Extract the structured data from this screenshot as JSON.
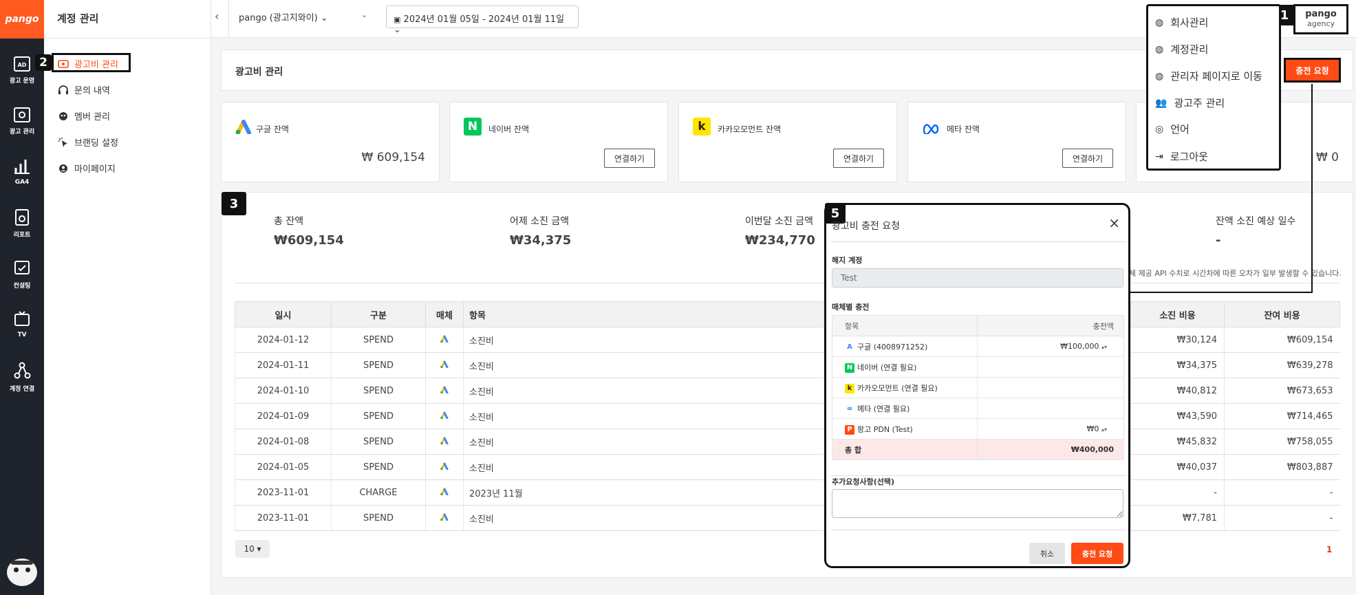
{
  "brand": {
    "logo_text": "pango",
    "accent": "#ff4b14"
  },
  "rail": [
    {
      "label": "광고 운영",
      "icon": "ad-icon"
    },
    {
      "label": "광고 관리",
      "icon": "gear-icon"
    },
    {
      "label": "GA4",
      "icon": "bar-chart-icon"
    },
    {
      "label": "리포트",
      "icon": "report-icon"
    },
    {
      "label": "컨설팅",
      "icon": "consulting-icon"
    },
    {
      "label": "TV",
      "icon": "tv-icon"
    },
    {
      "label": "계정 연결",
      "icon": "share-icon"
    }
  ],
  "sidebar": {
    "title": "계정 관리",
    "items": [
      {
        "label": "광고비 관리",
        "icon": "wallet-icon"
      },
      {
        "label": "문의 내역",
        "icon": "headset-icon"
      },
      {
        "label": "멤버 관리",
        "icon": "people-icon"
      },
      {
        "label": "브랜딩 설정",
        "icon": "click-icon"
      },
      {
        "label": "마이페이지",
        "icon": "user-icon"
      }
    ]
  },
  "annotations": [
    "1",
    "2",
    "3",
    "5"
  ],
  "topbar": {
    "account": "pango (광고지와이) ⌄",
    "date_range": "2024년 01월 05일 - 2024년 01월 11일 ⌄",
    "user_name": "pango",
    "user_role": "agency"
  },
  "user_menu": [
    {
      "label": "회사관리",
      "icon": "company-icon"
    },
    {
      "label": "계정관리",
      "icon": "account-icon"
    },
    {
      "label": "관리자 페이지로 이동",
      "icon": "admin-icon"
    },
    {
      "label": "광고주 관리",
      "icon": "advertiser-icon"
    },
    {
      "label": "언어",
      "icon": "globe-icon"
    },
    {
      "label": "로그아웃",
      "icon": "logout-icon"
    }
  ],
  "page": {
    "title": "광고비 관리",
    "charge_button": "충전 요청"
  },
  "balances": [
    {
      "label": "구글 잔액",
      "value": "₩ 609,154",
      "connect": ""
    },
    {
      "label": "네이버 잔액",
      "value": "",
      "connect": "연결하기"
    },
    {
      "label": "카카오모먼트 잔액",
      "value": "",
      "connect": "연결하기"
    },
    {
      "label": "메타 잔액",
      "value": "",
      "connect": "연결하기"
    },
    {
      "label": "",
      "value": "₩ 0",
      "connect": ""
    }
  ],
  "stats": [
    {
      "label": "총 잔액",
      "value": "₩609,154"
    },
    {
      "label": "어제 소진 금액",
      "value": "₩34,375"
    },
    {
      "label": "이번달 소진 금액",
      "value": "₩234,770"
    },
    {
      "label": "잔액 소진 예상 일수",
      "value": "-"
    }
  ],
  "note": "체 제공 API 수치로 시간차에 따른 오차가 일부 발생할 수 있습니다.",
  "table": {
    "headers": [
      "일시",
      "구분",
      "매체",
      "항목"
    ],
    "right_headers": [
      "소진 비용",
      "잔여 비용"
    ],
    "rows": [
      {
        "date": "2024-01-12",
        "type": "SPEND",
        "item": "소진비",
        "spend": "₩30,124",
        "remain": "₩609,154"
      },
      {
        "date": "2024-01-11",
        "type": "SPEND",
        "item": "소진비",
        "spend": "₩34,375",
        "remain": "₩639,278"
      },
      {
        "date": "2024-01-10",
        "type": "SPEND",
        "item": "소진비",
        "spend": "₩40,812",
        "remain": "₩673,653"
      },
      {
        "date": "2024-01-09",
        "type": "SPEND",
        "item": "소진비",
        "spend": "₩43,590",
        "remain": "₩714,465"
      },
      {
        "date": "2024-01-08",
        "type": "SPEND",
        "item": "소진비",
        "spend": "₩45,832",
        "remain": "₩758,055"
      },
      {
        "date": "2024-01-05",
        "type": "SPEND",
        "item": "소진비",
        "spend": "₩40,037",
        "remain": "₩803,887"
      },
      {
        "date": "2023-11-01",
        "type": "CHARGE",
        "item": "2023년 11월",
        "spend": "-",
        "remain": "-"
      },
      {
        "date": "2023-11-01",
        "type": "SPEND",
        "item": "소진비",
        "spend": "₩7,781",
        "remain": "-"
      }
    ]
  },
  "pager": {
    "size": "10 ▾",
    "page": "1"
  },
  "modal": {
    "title": "광고비 충전 요청",
    "close": "×",
    "account_label": "해지 계정",
    "account_value": "Test",
    "media_label": "매체별 충전",
    "col_item": "항목",
    "col_amount": "충전액",
    "rows": [
      {
        "badge": "A",
        "name": "구글 (4008971252)",
        "amount": "₩100,000"
      },
      {
        "badge": "N",
        "name": "네이버 (연결 필요)",
        "amount": ""
      },
      {
        "badge": "k",
        "name": "카카오모먼트 (연결 필요)",
        "amount": ""
      },
      {
        "badge": "∞",
        "name": "메타 (연결 필요)",
        "amount": ""
      },
      {
        "badge": "P",
        "name": "팡고 PDN (Test)",
        "amount": "₩0"
      }
    ],
    "total_label": "총 합",
    "total_value": "₩400,000",
    "extra_label": "추가요청사항(선택)",
    "cancel": "취소",
    "submit": "충전 요청"
  }
}
